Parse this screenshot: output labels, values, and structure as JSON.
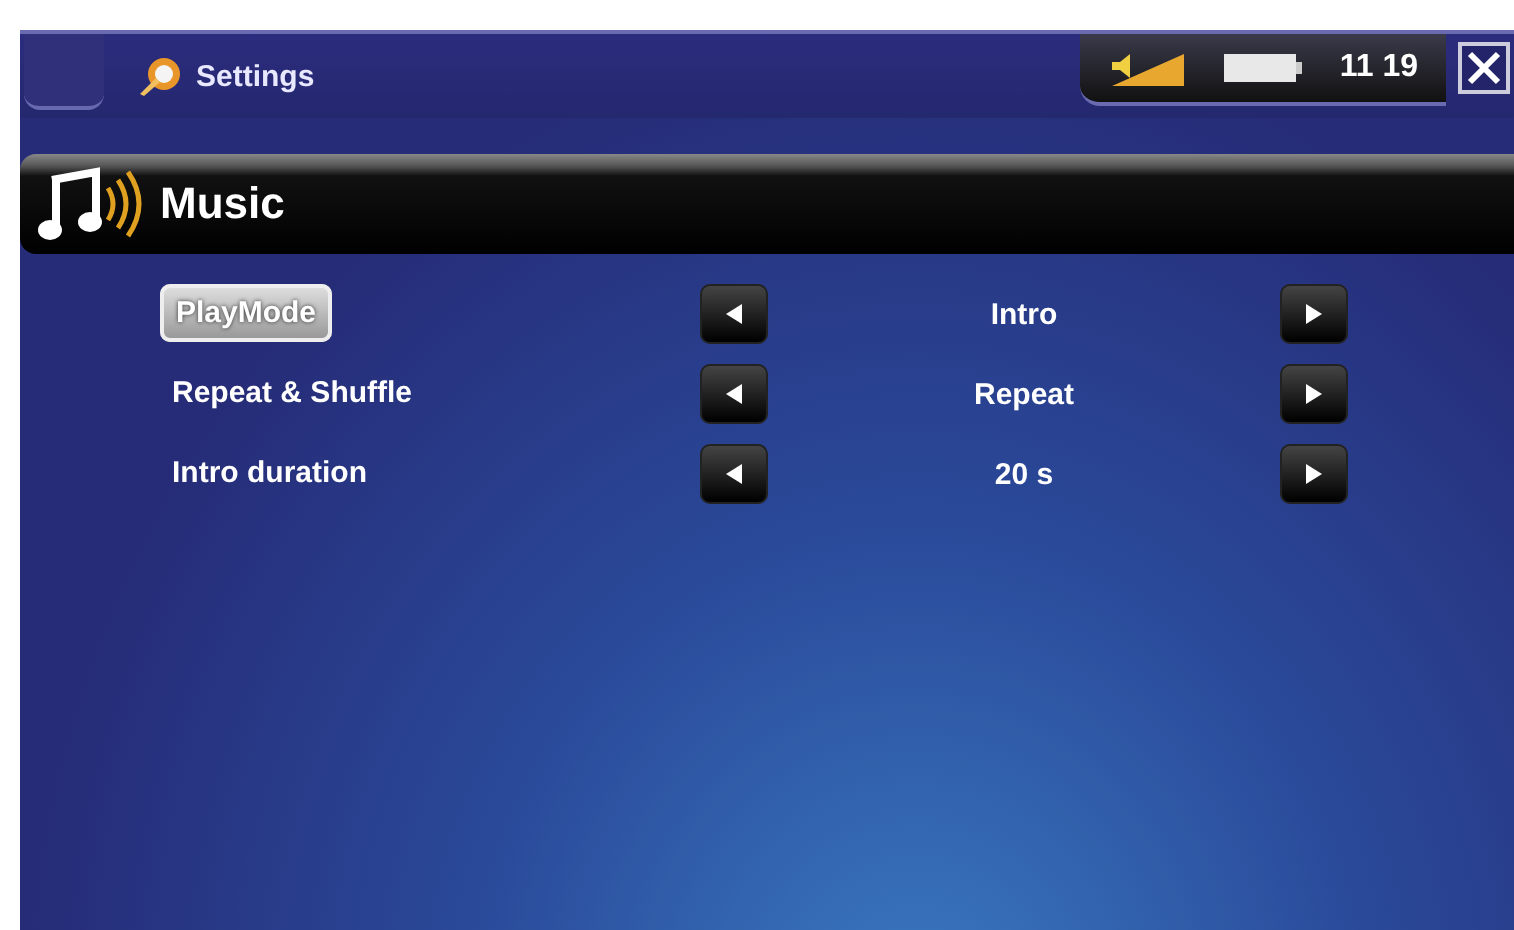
{
  "title_bar": {
    "title": "Settings",
    "clock": "11 19"
  },
  "section": {
    "title": "Music"
  },
  "settings": [
    {
      "label": "PlayMode",
      "value": "Intro",
      "selected": true
    },
    {
      "label": "Repeat & Shuffle",
      "value": "Repeat",
      "selected": false
    },
    {
      "label": "Intro duration",
      "value": "20 s",
      "selected": false
    }
  ]
}
